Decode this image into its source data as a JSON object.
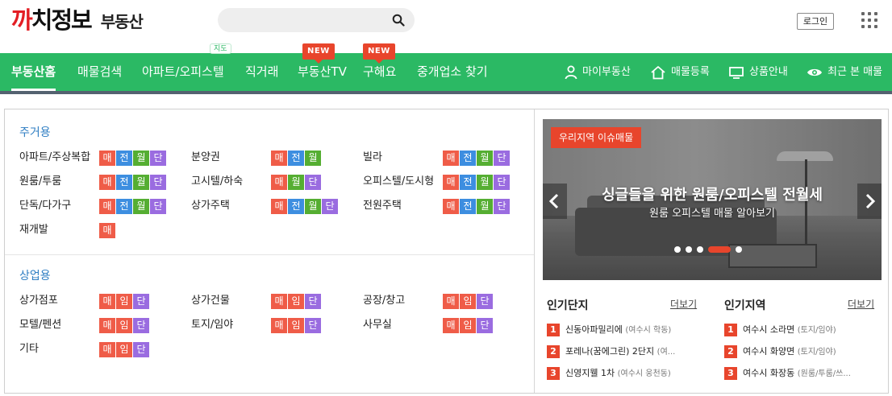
{
  "brand": {
    "logo_part1": "까",
    "logo_part2": "치정보",
    "logo_sub": "부동산"
  },
  "search": {
    "placeholder": ""
  },
  "header": {
    "login_label": "로그인"
  },
  "nav": {
    "items": [
      {
        "label": "부동산홈"
      },
      {
        "label": "매물검색"
      },
      {
        "label": "아파트/오피스텔",
        "badge": "지도"
      },
      {
        "label": "직거래"
      },
      {
        "label": "부동산TV",
        "badge": "NEW"
      },
      {
        "label": "구해요",
        "badge": "NEW"
      },
      {
        "label": "중개업소 찾기"
      }
    ],
    "right": [
      {
        "label": "마이부동산",
        "icon": "person-icon"
      },
      {
        "label": "매물등록",
        "icon": "house-icon"
      },
      {
        "label": "상품안내",
        "icon": "monitor-icon"
      },
      {
        "label": "최근 본 매물",
        "icon": "eye-icon"
      }
    ]
  },
  "residential": {
    "title": "주거용",
    "items": [
      {
        "label": "아파트/주상복합",
        "tags": [
          "매",
          "전",
          "월",
          "단"
        ]
      },
      {
        "label": "분양권",
        "tags": [
          "매",
          "전",
          "월"
        ]
      },
      {
        "label": "빌라",
        "tags": [
          "매",
          "전",
          "월",
          "단"
        ]
      },
      {
        "label": "원룸/투룸",
        "tags": [
          "매",
          "전",
          "월",
          "단"
        ]
      },
      {
        "label": "고시텔/하숙",
        "tags": [
          "매",
          "월",
          "단"
        ]
      },
      {
        "label": "오피스텔/도시형",
        "tags": [
          "매",
          "전",
          "월",
          "단"
        ]
      },
      {
        "label": "단독/다가구",
        "tags": [
          "매",
          "전",
          "월",
          "단"
        ]
      },
      {
        "label": "상가주택",
        "tags": [
          "매",
          "전",
          "월",
          "단"
        ]
      },
      {
        "label": "전원주택",
        "tags": [
          "매",
          "전",
          "월",
          "단"
        ]
      },
      {
        "label": "재개발",
        "tags": [
          "매"
        ]
      }
    ]
  },
  "commercial": {
    "title": "상업용",
    "items": [
      {
        "label": "상가점포",
        "tags": [
          "매",
          "임",
          "단"
        ]
      },
      {
        "label": "상가건물",
        "tags": [
          "매",
          "임",
          "단"
        ]
      },
      {
        "label": "공장/창고",
        "tags": [
          "매",
          "임",
          "단"
        ]
      },
      {
        "label": "모텔/펜션",
        "tags": [
          "매",
          "임",
          "단"
        ]
      },
      {
        "label": "토지/임야",
        "tags": [
          "매",
          "임",
          "단"
        ]
      },
      {
        "label": "사무실",
        "tags": [
          "매",
          "임",
          "단"
        ]
      },
      {
        "label": "기타",
        "tags": [
          "매",
          "임",
          "단"
        ]
      }
    ]
  },
  "banner": {
    "tag": "우리지역 이슈매물",
    "headline": "싱글들을 위한 원룸/오피스텔 전월세",
    "sub": "원룸 오피스텔 매물 알아보기",
    "slide_count": 6,
    "active_slide": 4
  },
  "popular_complex": {
    "title": "인기단지",
    "more": "더보기",
    "items": [
      {
        "rank": "1",
        "name": "신동아파밀리에",
        "sub": "(여수시 학동)"
      },
      {
        "rank": "2",
        "name": "포레나(꿈에그린) 2단지",
        "sub": "(여..."
      },
      {
        "rank": "3",
        "name": "신영지웰 1차",
        "sub": "(여수시 웅천동)"
      }
    ]
  },
  "popular_region": {
    "title": "인기지역",
    "more": "더보기",
    "items": [
      {
        "rank": "1",
        "name": "여수시 소라면",
        "sub": "(토지/임야)"
      },
      {
        "rank": "2",
        "name": "여수시 화양면",
        "sub": "(토지/임야)"
      },
      {
        "rank": "3",
        "name": "여수시 화장동",
        "sub": "(원룸/투룸/쓰..."
      }
    ]
  },
  "colors": {
    "nav_green": "#2bb964",
    "accent_red": "#e8452c",
    "tag_sale": "#ef5c48",
    "tag_jeonse": "#3d8ee0",
    "tag_monthly": "#55ae32",
    "tag_short": "#9a6ce0",
    "section_blue": "#2f7ec3"
  }
}
